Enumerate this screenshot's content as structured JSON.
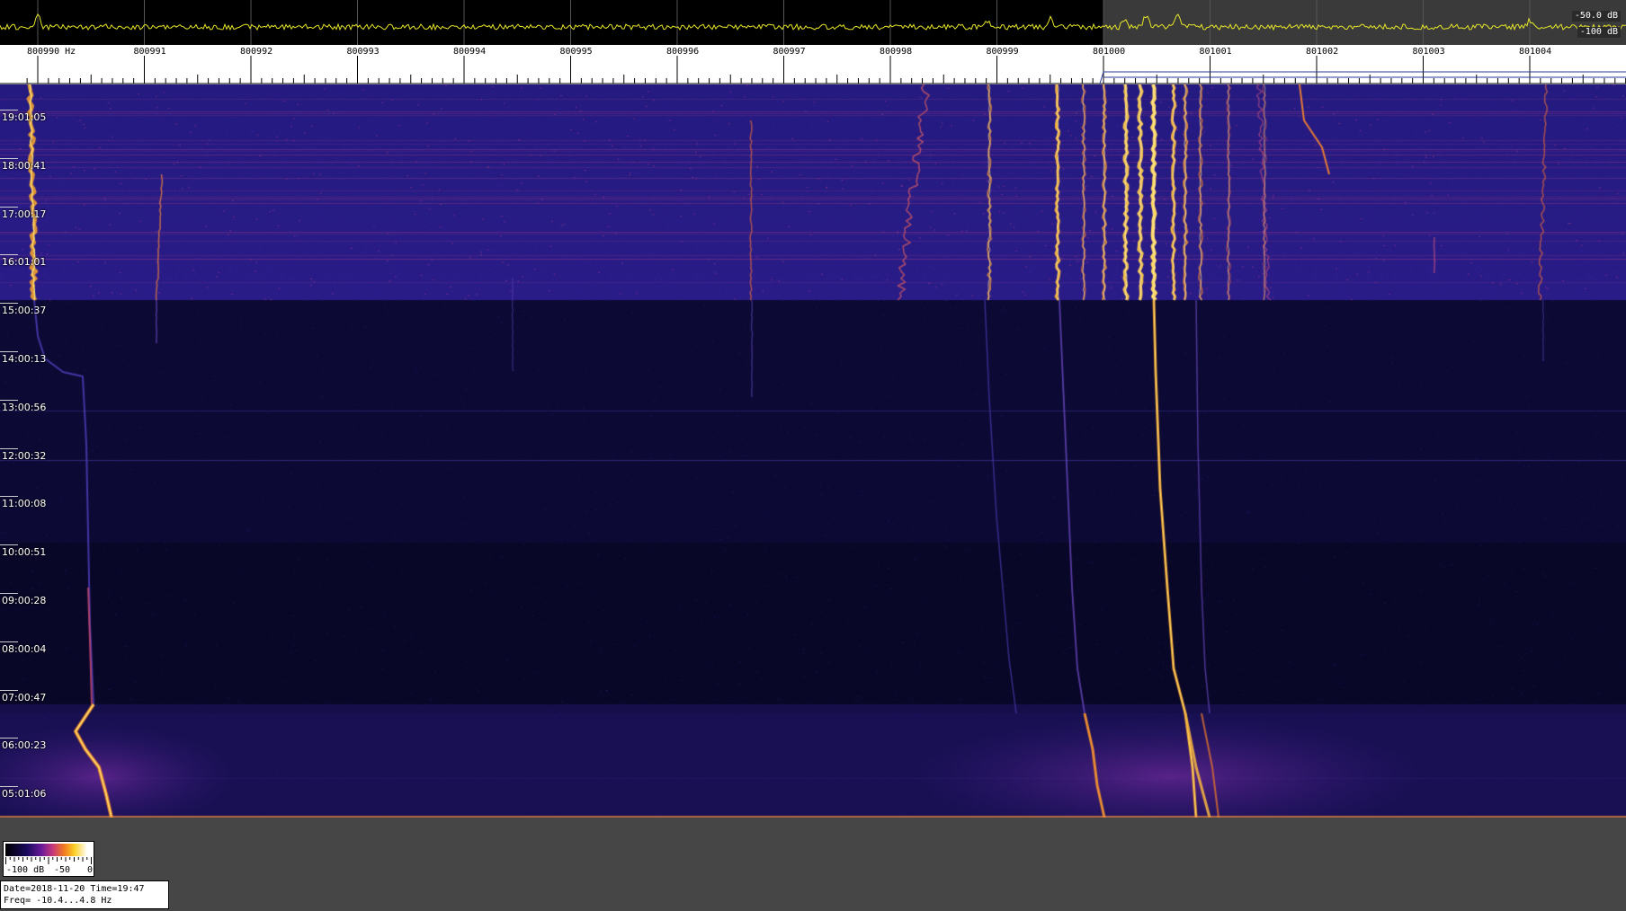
{
  "spectrum": {
    "db_top": "-50.0 dB",
    "db_bottom": "-100 dB",
    "trace_color": "#e6e62a"
  },
  "chart_data": {
    "type": "heatmap",
    "subtype": "spectrogram-waterfall",
    "x_unit": "Hz",
    "xlim": [
      800989.87,
      801005.05
    ],
    "x_tick_labels": [
      "800990 Hz",
      "800991",
      "800992",
      "800993",
      "800994",
      "800995",
      "800996",
      "800997",
      "800998",
      "800999",
      "801000",
      "801001",
      "801002",
      "801003",
      "801004"
    ],
    "x_ticks": [
      800990,
      800991,
      800992,
      800993,
      800994,
      800995,
      800996,
      800997,
      800998,
      800999,
      801000,
      801001,
      801002,
      801003,
      801004
    ],
    "y_tick_labels": [
      "19:01:05",
      "18:00:41",
      "17:00:17",
      "16:01:01",
      "15:00:37",
      "14:00:13",
      "13:00:56",
      "12:00:32",
      "11:00:08",
      "10:00:51",
      "09:00:28",
      "08:00:04",
      "07:00:47",
      "06:00:23",
      "05:01:06"
    ],
    "color_scale": {
      "min_label": "-100 dB",
      "mid_label": "-50",
      "max_label": "0",
      "colors": [
        "#000000",
        "#1a0a5e",
        "#6a1a9a",
        "#c83878",
        "#f07a20",
        "#fbd028",
        "#ffffff"
      ]
    },
    "grid": false
  },
  "info": {
    "line1": "Date=2018-11-20 Time=19:47",
    "line2": "Freq= -10.4...4.8 Hz"
  }
}
